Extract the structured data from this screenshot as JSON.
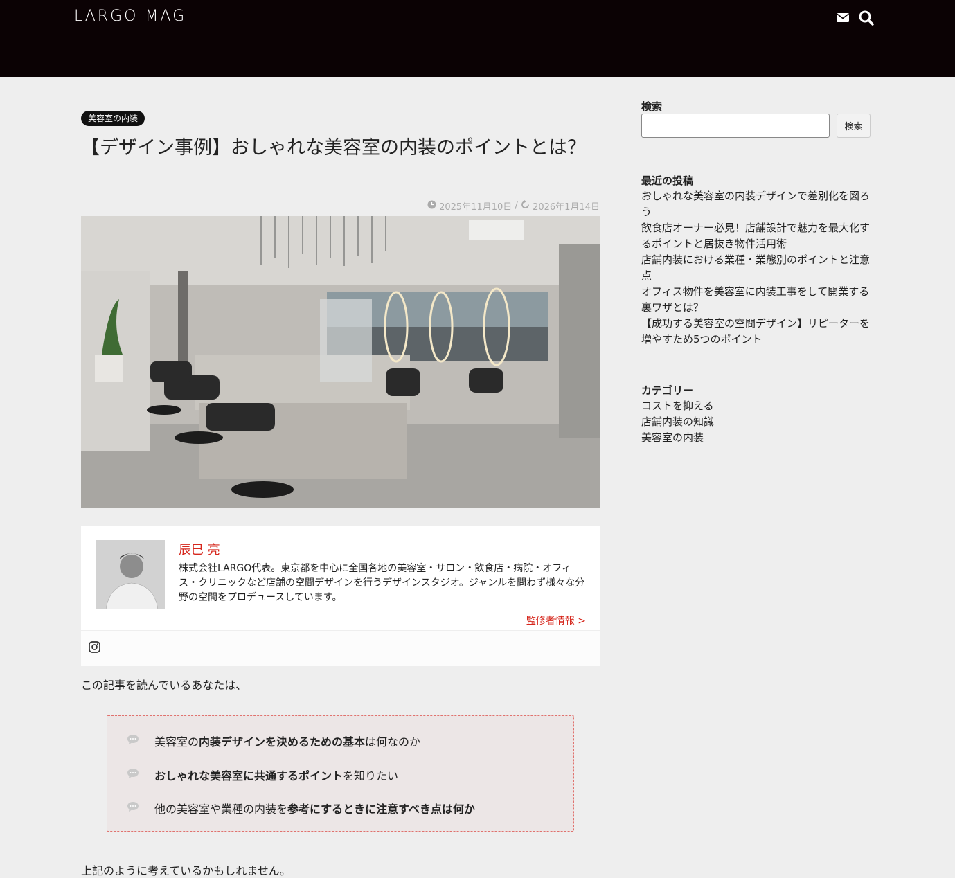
{
  "header": {
    "logo": "LARGO MAG"
  },
  "article": {
    "category_badge": "美容室の内装",
    "title": "【デザイン事例】おしゃれな美容室の内装のポイントとは？",
    "published": "2025年11月10日",
    "date_separator": "/",
    "updated": "2026年1月14日",
    "intro": "この記事を読んでいるあなたは、",
    "checklist": [
      {
        "pre": "美容室の",
        "bold": "内装デザインを決めるための基本",
        "post": "は何なのか"
      },
      {
        "pre": "",
        "bold": "おしゃれな美容室に共通するポイント",
        "post": "を知りたい"
      },
      {
        "pre": "他の美容室や業種の内装を",
        "bold": "参考にするときに注意すべき点は何か",
        "post": ""
      }
    ],
    "after_checklist": "上記のように考えているかもしれません。"
  },
  "author": {
    "name": "辰巳 亮",
    "bio": "株式会社LARGO代表。東京都を中心に全国各地の美容室・サロン・飲食店・病院・オフィス・クリニックなど店舗の空間デザインを行うデザインスタジオ。ジャンルを問わず様々な分野の空間をプロデュースしています。",
    "link": "監修者情報 >"
  },
  "sidebar": {
    "search_label": "検索",
    "search_value": "",
    "search_button": "検索",
    "recent_title": "最近の投稿",
    "recent_posts": [
      "おしゃれな美容室の内装デザインで差別化を図ろう",
      "飲食店オーナー必見！店舗設計で魅力を最大化するポイントと居抜き物件活用術",
      "店舗内装における業種・業態別のポイントと注意点",
      "オフィス物件を美容室に内装工事をして開業する裏ワザとは？",
      "【成功する美容室の空間デザイン】リピーターを増やすため5つのポイント"
    ],
    "category_title": "カテゴリー",
    "categories": [
      "コストを抑える",
      "店舗内装の知識",
      "美容室の内装"
    ]
  },
  "colors": {
    "header_bg": "#0b0204",
    "accent_red": "#d6281e",
    "page_bg": "#eeeeee"
  }
}
